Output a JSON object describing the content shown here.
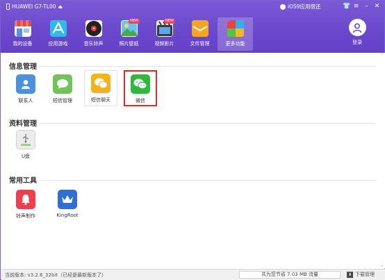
{
  "titlebar": {
    "device_name": "HUAWEI G7-TL00",
    "promo_text": "iOS9应用借还"
  },
  "nav": {
    "items": [
      {
        "label": "我的设备"
      },
      {
        "label": "应用游戏"
      },
      {
        "label": "音乐铃声"
      },
      {
        "label": "照片壁纸",
        "badge": "NEW"
      },
      {
        "label": "视频影片",
        "badge": "NEW"
      },
      {
        "label": "文件管理"
      },
      {
        "label": "更多功能"
      }
    ],
    "active_index": 6,
    "login_label": "登录"
  },
  "sections": {
    "info": {
      "title": "信息管理",
      "apps": [
        {
          "label": "联系人",
          "icon": "contacts-icon"
        },
        {
          "label": "短信管理",
          "icon": "sms-icon"
        },
        {
          "label": "短信聊天",
          "icon": "chat-icon"
        },
        {
          "label": "微信",
          "icon": "wechat-icon"
        }
      ]
    },
    "data": {
      "title": "资料管理",
      "apps": [
        {
          "label": "U盘",
          "icon": "usb-drive-icon"
        }
      ]
    },
    "tools": {
      "title": "常用工具",
      "apps": [
        {
          "label": "铃声制作",
          "icon": "bell-icon"
        },
        {
          "label": "KingRoot",
          "icon": "kingroot-crown-icon"
        }
      ]
    }
  },
  "statusbar": {
    "version": "当前版本: v3.2.6_32bit（已经是最新版本了）",
    "capacity": "共为您节省 7.03 MB 流量",
    "download": "下载管理"
  },
  "colors": {
    "header": "#6a47cc",
    "selected_border": "#e02b2b"
  }
}
